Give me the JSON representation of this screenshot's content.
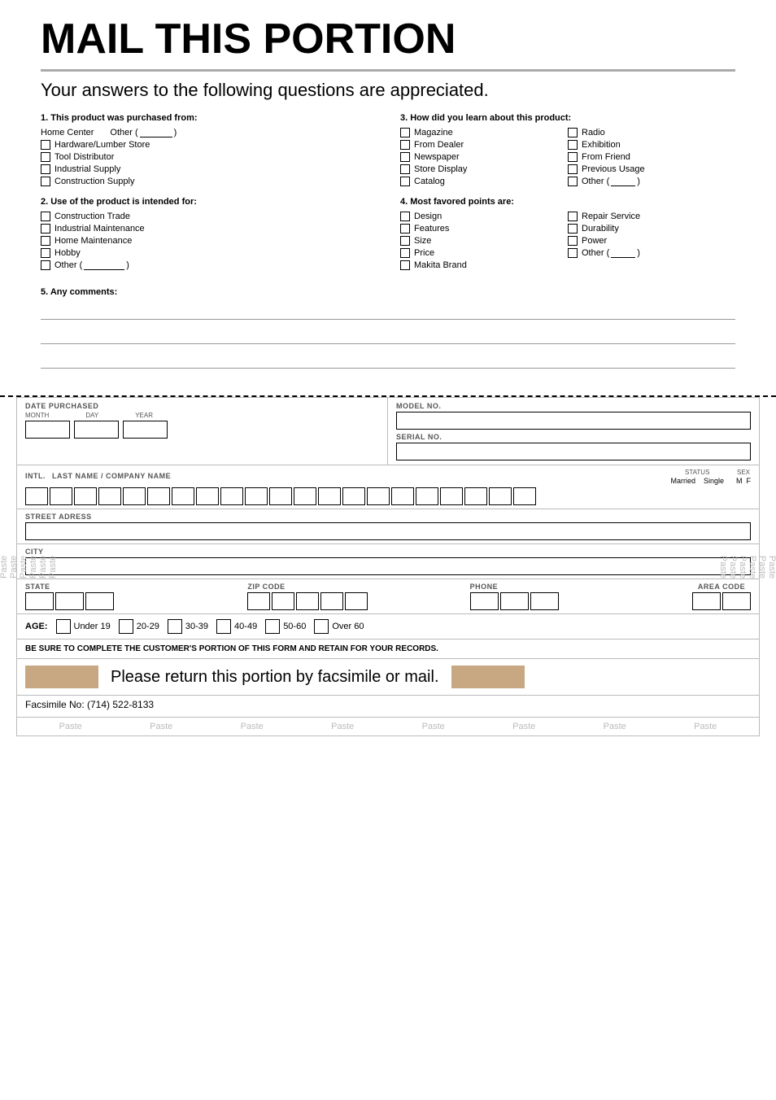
{
  "page": {
    "title": "MAIL THIS PORTION",
    "subtitle": "Your answers to the following questions are appreciated.",
    "q1": {
      "title": "1. This product was purchased from:",
      "options": [
        "Home Center",
        "Hardware/Lumber Store",
        "Tool Distributor",
        "Industrial Supply",
        "Construction Supply"
      ],
      "other_label": "Other (",
      "other_close": ")"
    },
    "q2": {
      "title": "2. Use of the product is intended for:",
      "options": [
        "Construction Trade",
        "Industrial Maintenance",
        "Home Maintenance",
        "Hobby"
      ],
      "other_label": "Other (",
      "other_close": ")"
    },
    "q3": {
      "title": "3. How did you learn about this product:",
      "col1": [
        "Magazine",
        "From Dealer",
        "Newspaper",
        "Store Display",
        "Catalog"
      ],
      "col2": [
        "Radio",
        "Exhibition",
        "From Friend",
        "Previous Usage"
      ],
      "other_label": "Other (",
      "other_close": ")"
    },
    "q4": {
      "title": "4. Most favored points are:",
      "col1": [
        "Design",
        "Features",
        "Size",
        "Price",
        "Makita Brand"
      ],
      "col2": [
        "Repair Service",
        "Durability",
        "Power"
      ],
      "other_label": "Other (",
      "other_close": ")"
    },
    "q5": {
      "title": "5. Any comments:"
    },
    "form": {
      "date_purchased": "DATE PURCHASED",
      "month_label": "MONTH",
      "day_label": "DAY",
      "year_label": "YEAR",
      "model_no_label": "MODEL NO.",
      "serial_no_label": "SERIAL NO.",
      "intl_label": "INTL.",
      "name_label": "LAST NAME / COMPANY NAME",
      "status_label": "STATUS",
      "married_label": "Married",
      "single_label": "Single",
      "sex_label": "SEX",
      "m_label": "M",
      "f_label": "F",
      "street_label": "STREET ADRESS",
      "city_label": "CITY",
      "state_label": "STATE",
      "zip_label": "ZIP CODE",
      "phone_label": "PHONE",
      "area_code_label": "AREA CODE",
      "age_label": "AGE:",
      "age_options": [
        "Under 19",
        "20-29",
        "30-39",
        "40-49",
        "50-60",
        "Over 60"
      ],
      "notice": "BE SURE TO COMPLETE THE CUSTOMER'S PORTION OF THIS FORM AND RETAIN FOR YOUR RECORDS.",
      "return_text": "Please return this portion by facsimile or mail.",
      "fax_text": "Facsimile No: (714) 522-8133",
      "paste_labels": [
        "Paste",
        "Paste",
        "Paste",
        "Paste",
        "Paste",
        "Paste",
        "Paste",
        "Paste"
      ]
    }
  }
}
